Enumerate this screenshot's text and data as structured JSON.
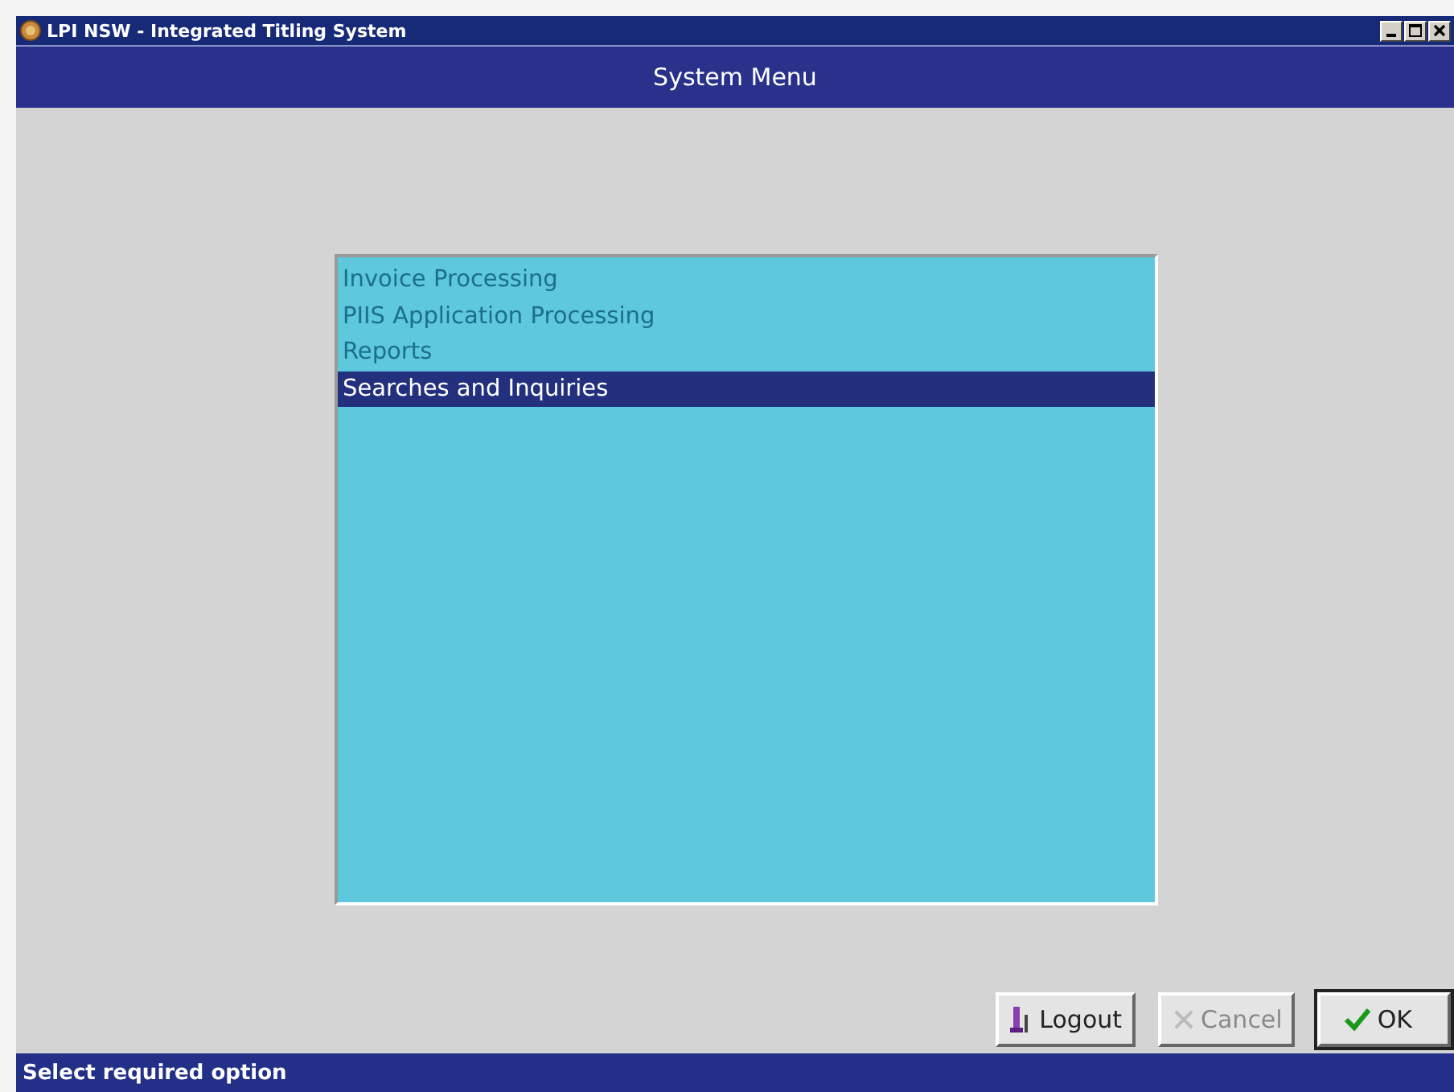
{
  "window": {
    "title": "LPI NSW - Integrated Titling System"
  },
  "header": {
    "title": "System Menu"
  },
  "menu": {
    "items": [
      {
        "label": "Invoice Processing",
        "selected": false
      },
      {
        "label": "PIIS Application Processing",
        "selected": false
      },
      {
        "label": "Reports",
        "selected": false
      },
      {
        "label": "Searches and Inquiries",
        "selected": true
      }
    ]
  },
  "buttons": [
    {
      "label": "Logout",
      "kind": "logout",
      "disabled": false
    },
    {
      "label": "Cancel",
      "kind": "cancel",
      "disabled": true
    },
    {
      "label": "OK",
      "kind": "ok",
      "disabled": false
    }
  ],
  "status_bar": {
    "text": "Select required option"
  }
}
